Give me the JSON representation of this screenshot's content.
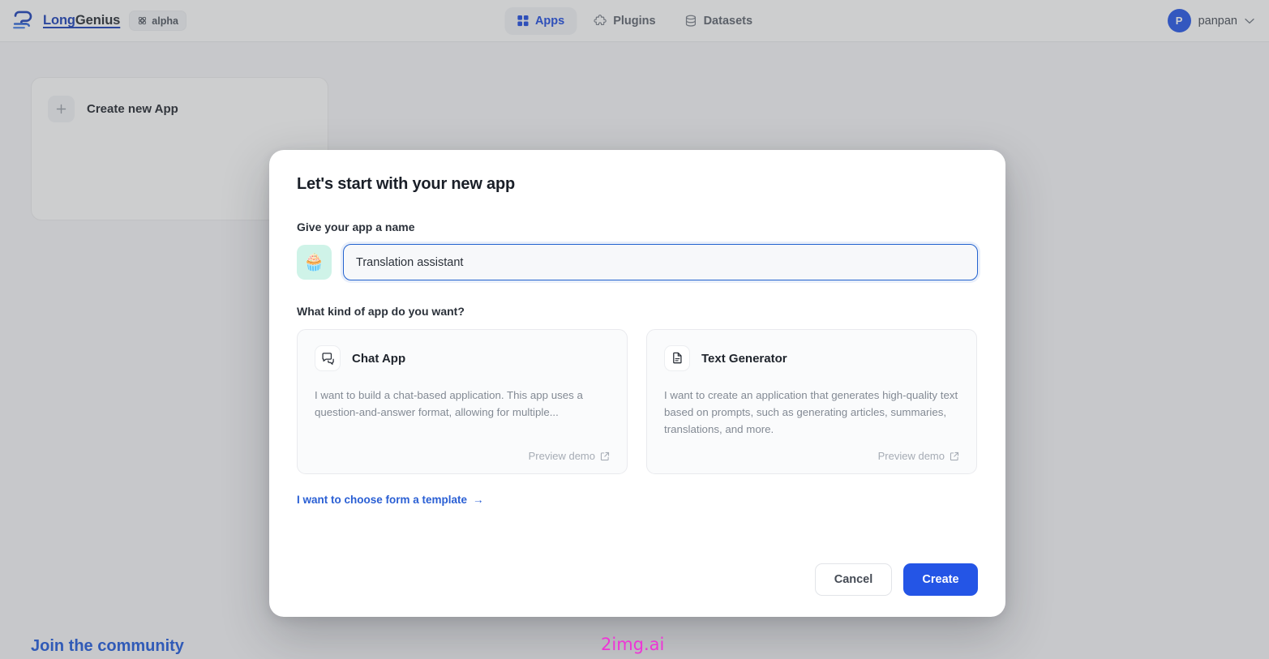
{
  "topbar": {
    "logo_icon": "longgenius-logo-icon",
    "brand_first": "Long",
    "brand_second": "Genius",
    "alpha_badge": {
      "icon": "atom-icon",
      "label": "alpha"
    },
    "nav": [
      {
        "label": "Apps",
        "icon": "grid-apps-icon",
        "active": true
      },
      {
        "label": "Plugins",
        "icon": "puzzle-icon",
        "active": false
      },
      {
        "label": "Datasets",
        "icon": "database-icon",
        "active": false
      }
    ],
    "user": {
      "avatar_initial": "P",
      "name": "panpan",
      "chevron_icon": "chevron-down-icon"
    }
  },
  "background": {
    "create_card": {
      "plus_icon": "plus-icon",
      "label": "Create new App"
    },
    "community_heading": "Join the community"
  },
  "watermark": {
    "text": "2img.ai"
  },
  "modal": {
    "title": "Let's start with your new app",
    "name_section": {
      "label": "Give your app a name",
      "emoji": "🧁",
      "emoji_icon": "cupcake-emoji-icon",
      "value": "Translation assistant",
      "placeholder": "Give your app a name"
    },
    "kind_section": {
      "label": "What kind of app do you want?",
      "options": [
        {
          "icon": "chat-bubbles-icon",
          "title": "Chat App",
          "description": "I want to build a chat-based application. This app uses a question-and-answer format, allowing for multiple...",
          "preview_label": "Preview demo",
          "preview_icon": "external-link-icon"
        },
        {
          "icon": "document-text-icon",
          "title": "Text Generator",
          "description": "I want to create an application that generates high-quality text based on prompts, such as generating articles, summaries, translations, and more.",
          "preview_label": "Preview demo",
          "preview_icon": "external-link-icon"
        }
      ]
    },
    "template_link": {
      "label": "I want to choose form a template",
      "arrow": "→"
    },
    "actions": {
      "cancel_label": "Cancel",
      "create_label": "Create"
    }
  },
  "colors": {
    "accent_blue": "#2455e6",
    "brand_blue": "#1b3fb8",
    "link_blue": "#2a5fd4",
    "emoji_bg": "#cff3e8",
    "watermark_pink": "#ee35d6"
  }
}
